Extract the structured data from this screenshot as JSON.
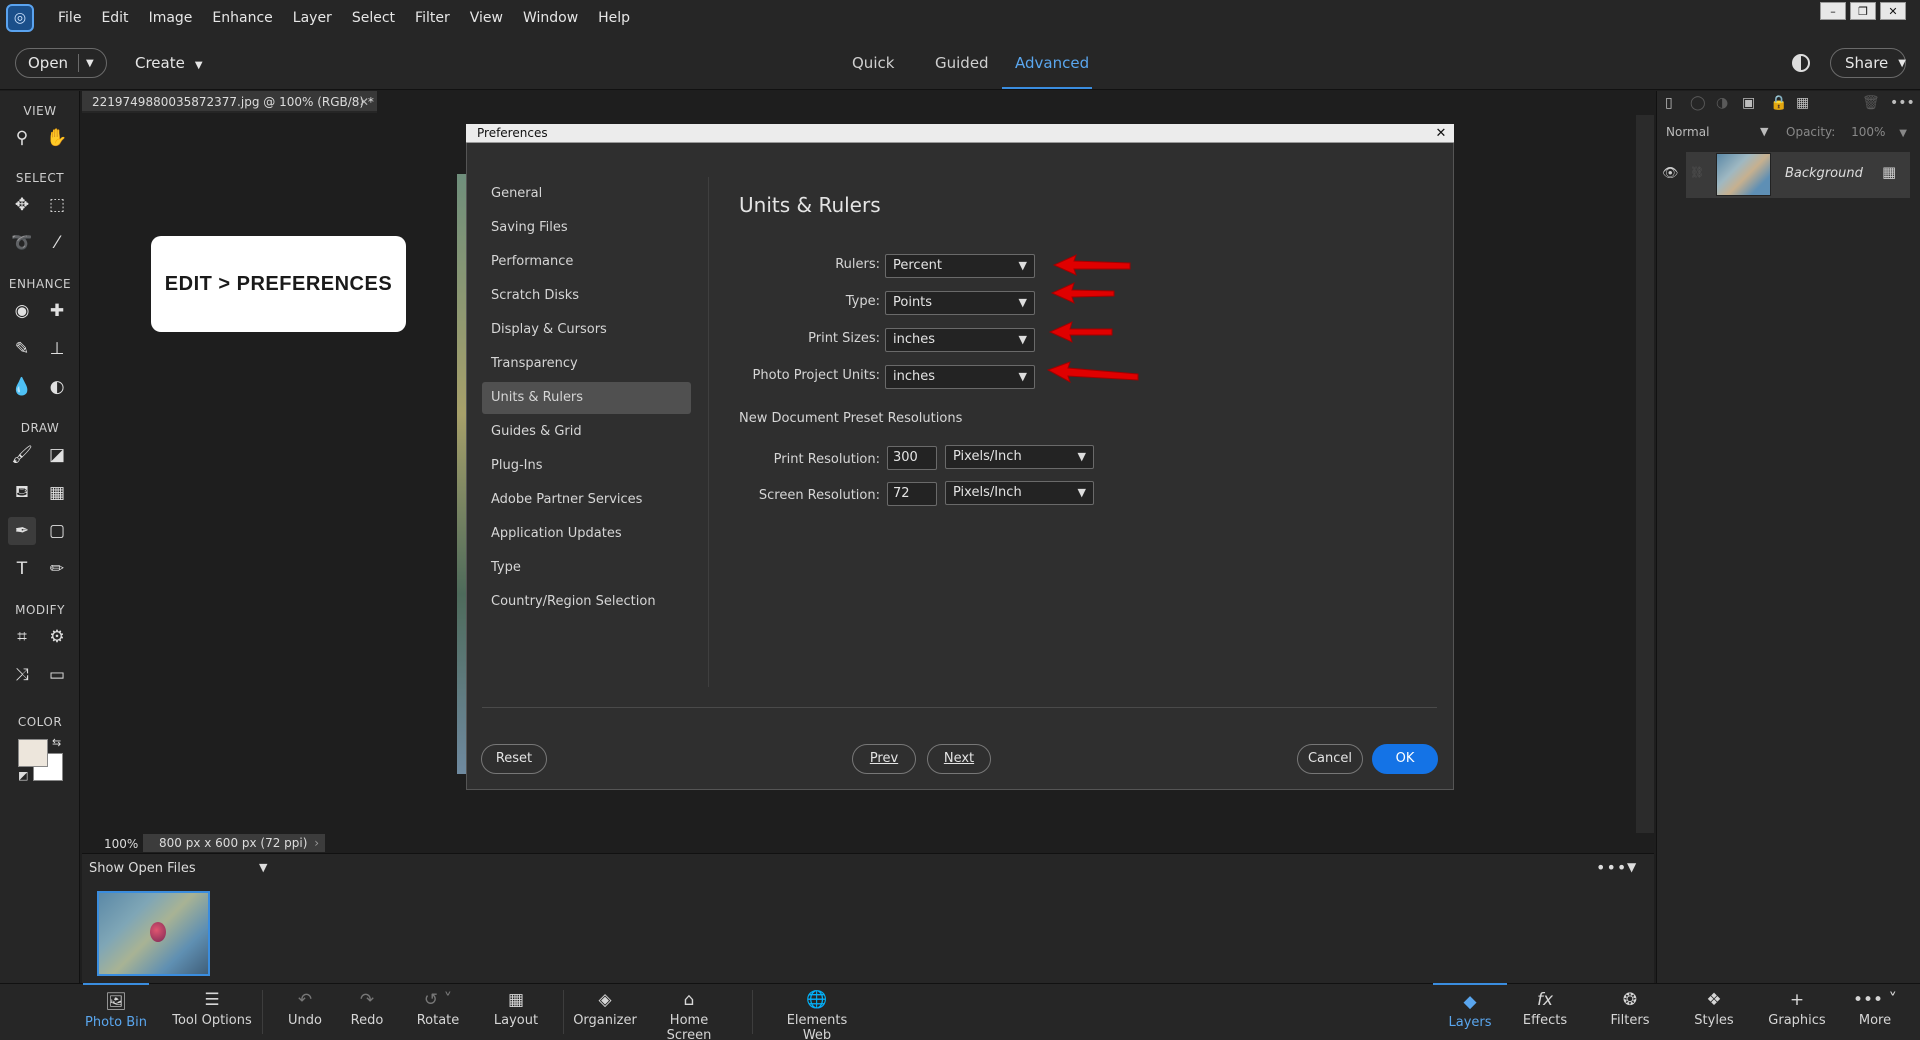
{
  "menubar": {
    "items": [
      "File",
      "Edit",
      "Image",
      "Enhance",
      "Layer",
      "Select",
      "Filter",
      "View",
      "Window",
      "Help"
    ]
  },
  "topbar": {
    "open_label": "Open",
    "create_label": "Create",
    "modes": [
      "Quick",
      "Guided",
      "Advanced"
    ],
    "active_mode": "Advanced",
    "share_label": "Share"
  },
  "toolbar": {
    "view_heading": "VIEW",
    "select_heading": "SELECT",
    "enhance_heading": "ENHANCE",
    "draw_heading": "DRAW",
    "modify_heading": "MODIFY",
    "color_heading": "COLOR",
    "foreground_color": "#ede6dc",
    "background_color": "#ffffff"
  },
  "document": {
    "tab_title": "2219749880035872377.jpg @ 100% (RGB/8) *",
    "zoom": "100%",
    "size_info": "800 px x 600 px (72 ppi)"
  },
  "callout": {
    "text": "EDIT > PREFERENCES"
  },
  "photobin": {
    "dropdown_label": "Show Open Files"
  },
  "preferences": {
    "title": "Preferences",
    "nav": [
      "General",
      "Saving Files",
      "Performance",
      "Scratch Disks",
      "Display & Cursors",
      "Transparency",
      "Units & Rulers",
      "Guides & Grid",
      "Plug-Ins",
      "Adobe Partner Services",
      "Application Updates",
      "Type",
      "Country/Region Selection"
    ],
    "selected_nav": "Units & Rulers",
    "section_title": "Units & Rulers",
    "rulers_label": "Rulers:",
    "rulers_value": "Percent",
    "type_label": "Type:",
    "type_value": "Points",
    "print_sizes_label": "Print Sizes:",
    "print_sizes_value": "inches",
    "photo_project_label": "Photo Project Units:",
    "photo_project_value": "inches",
    "preset_heading": "New Document Preset Resolutions",
    "print_res_label": "Print Resolution:",
    "print_res_value": "300",
    "print_res_unit": "Pixels/Inch",
    "screen_res_label": "Screen Resolution:",
    "screen_res_value": "72",
    "screen_res_unit": "Pixels/Inch",
    "reset_label": "Reset",
    "prev_label": "Prev",
    "next_label": "Next",
    "cancel_label": "Cancel",
    "ok_label": "OK"
  },
  "layers_panel": {
    "blend_mode": "Normal",
    "opacity_label": "Opacity:",
    "opacity_value": "100%",
    "layer_name": "Background"
  },
  "bottombar": {
    "items": [
      "Photo Bin",
      "Tool Options",
      "Undo",
      "Redo",
      "Rotate",
      "Layout",
      "Organizer",
      "Home Screen",
      "Elements Web"
    ],
    "right_items": [
      "Layers",
      "Effects",
      "Filters",
      "Styles",
      "Graphics",
      "More"
    ]
  },
  "colors": {
    "accent": "#1473e6",
    "arrow": "#e00000"
  }
}
